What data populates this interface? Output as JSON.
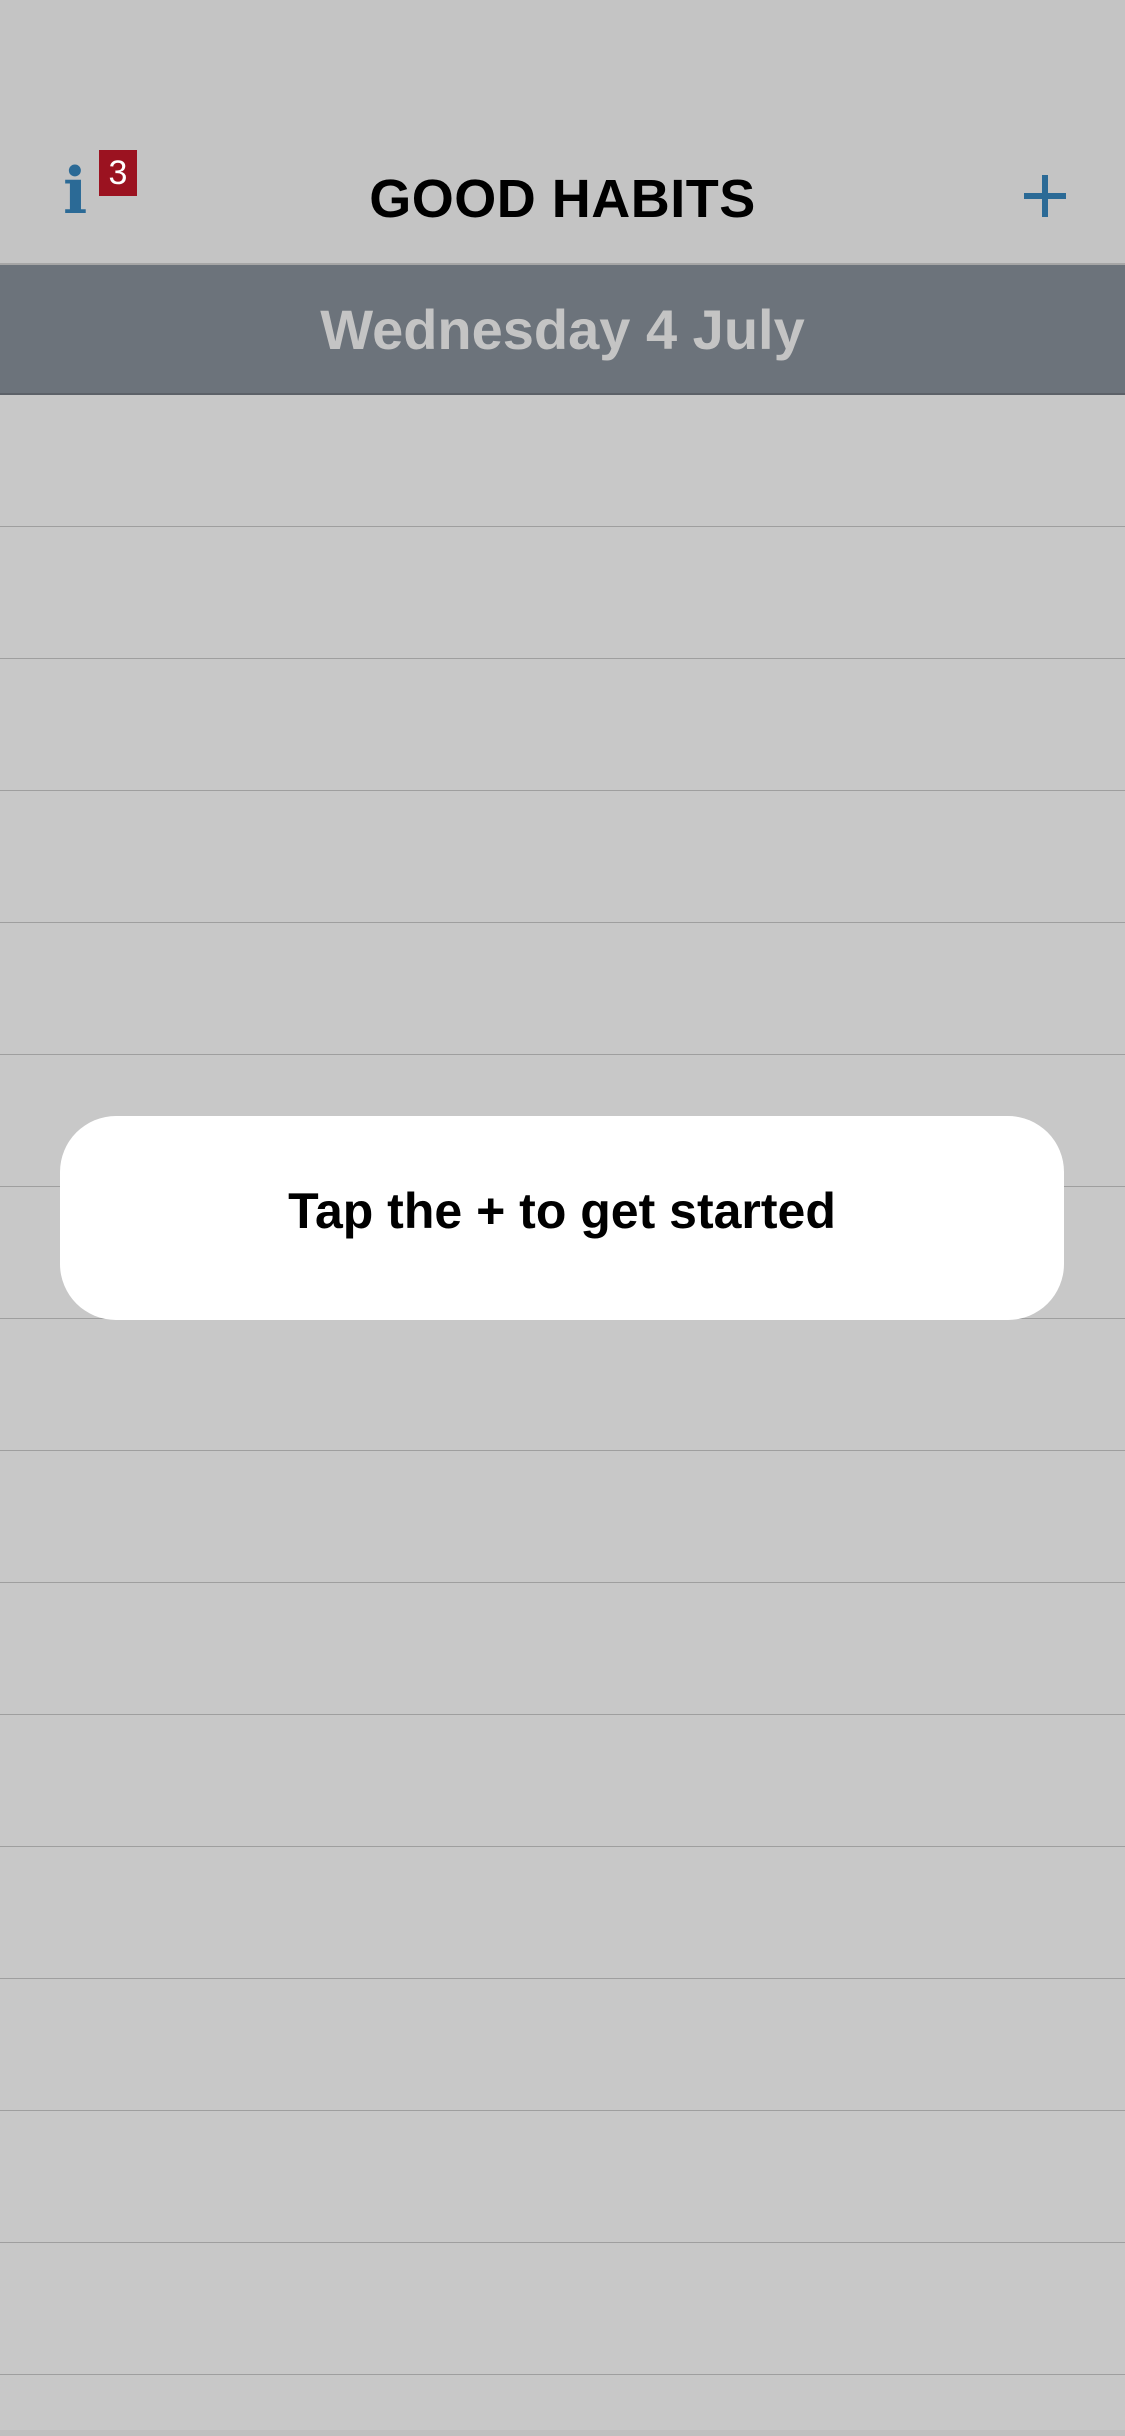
{
  "app": {
    "title": "GOOD HABITS"
  },
  "toolbar": {
    "info_icon": "info-icon",
    "info_glyph": "i",
    "info_badge_count": "3",
    "add_icon": "plus-icon"
  },
  "date_header": {
    "label": "Wednesday 4 July"
  },
  "list": {
    "row_count": 16
  },
  "hint": {
    "text": "Tap the + to get started"
  },
  "colors": {
    "background": "#c8c8c8",
    "date_header_bg": "#6c737b",
    "accent_blue": "#2b6a96",
    "badge_red": "#9b1220"
  }
}
